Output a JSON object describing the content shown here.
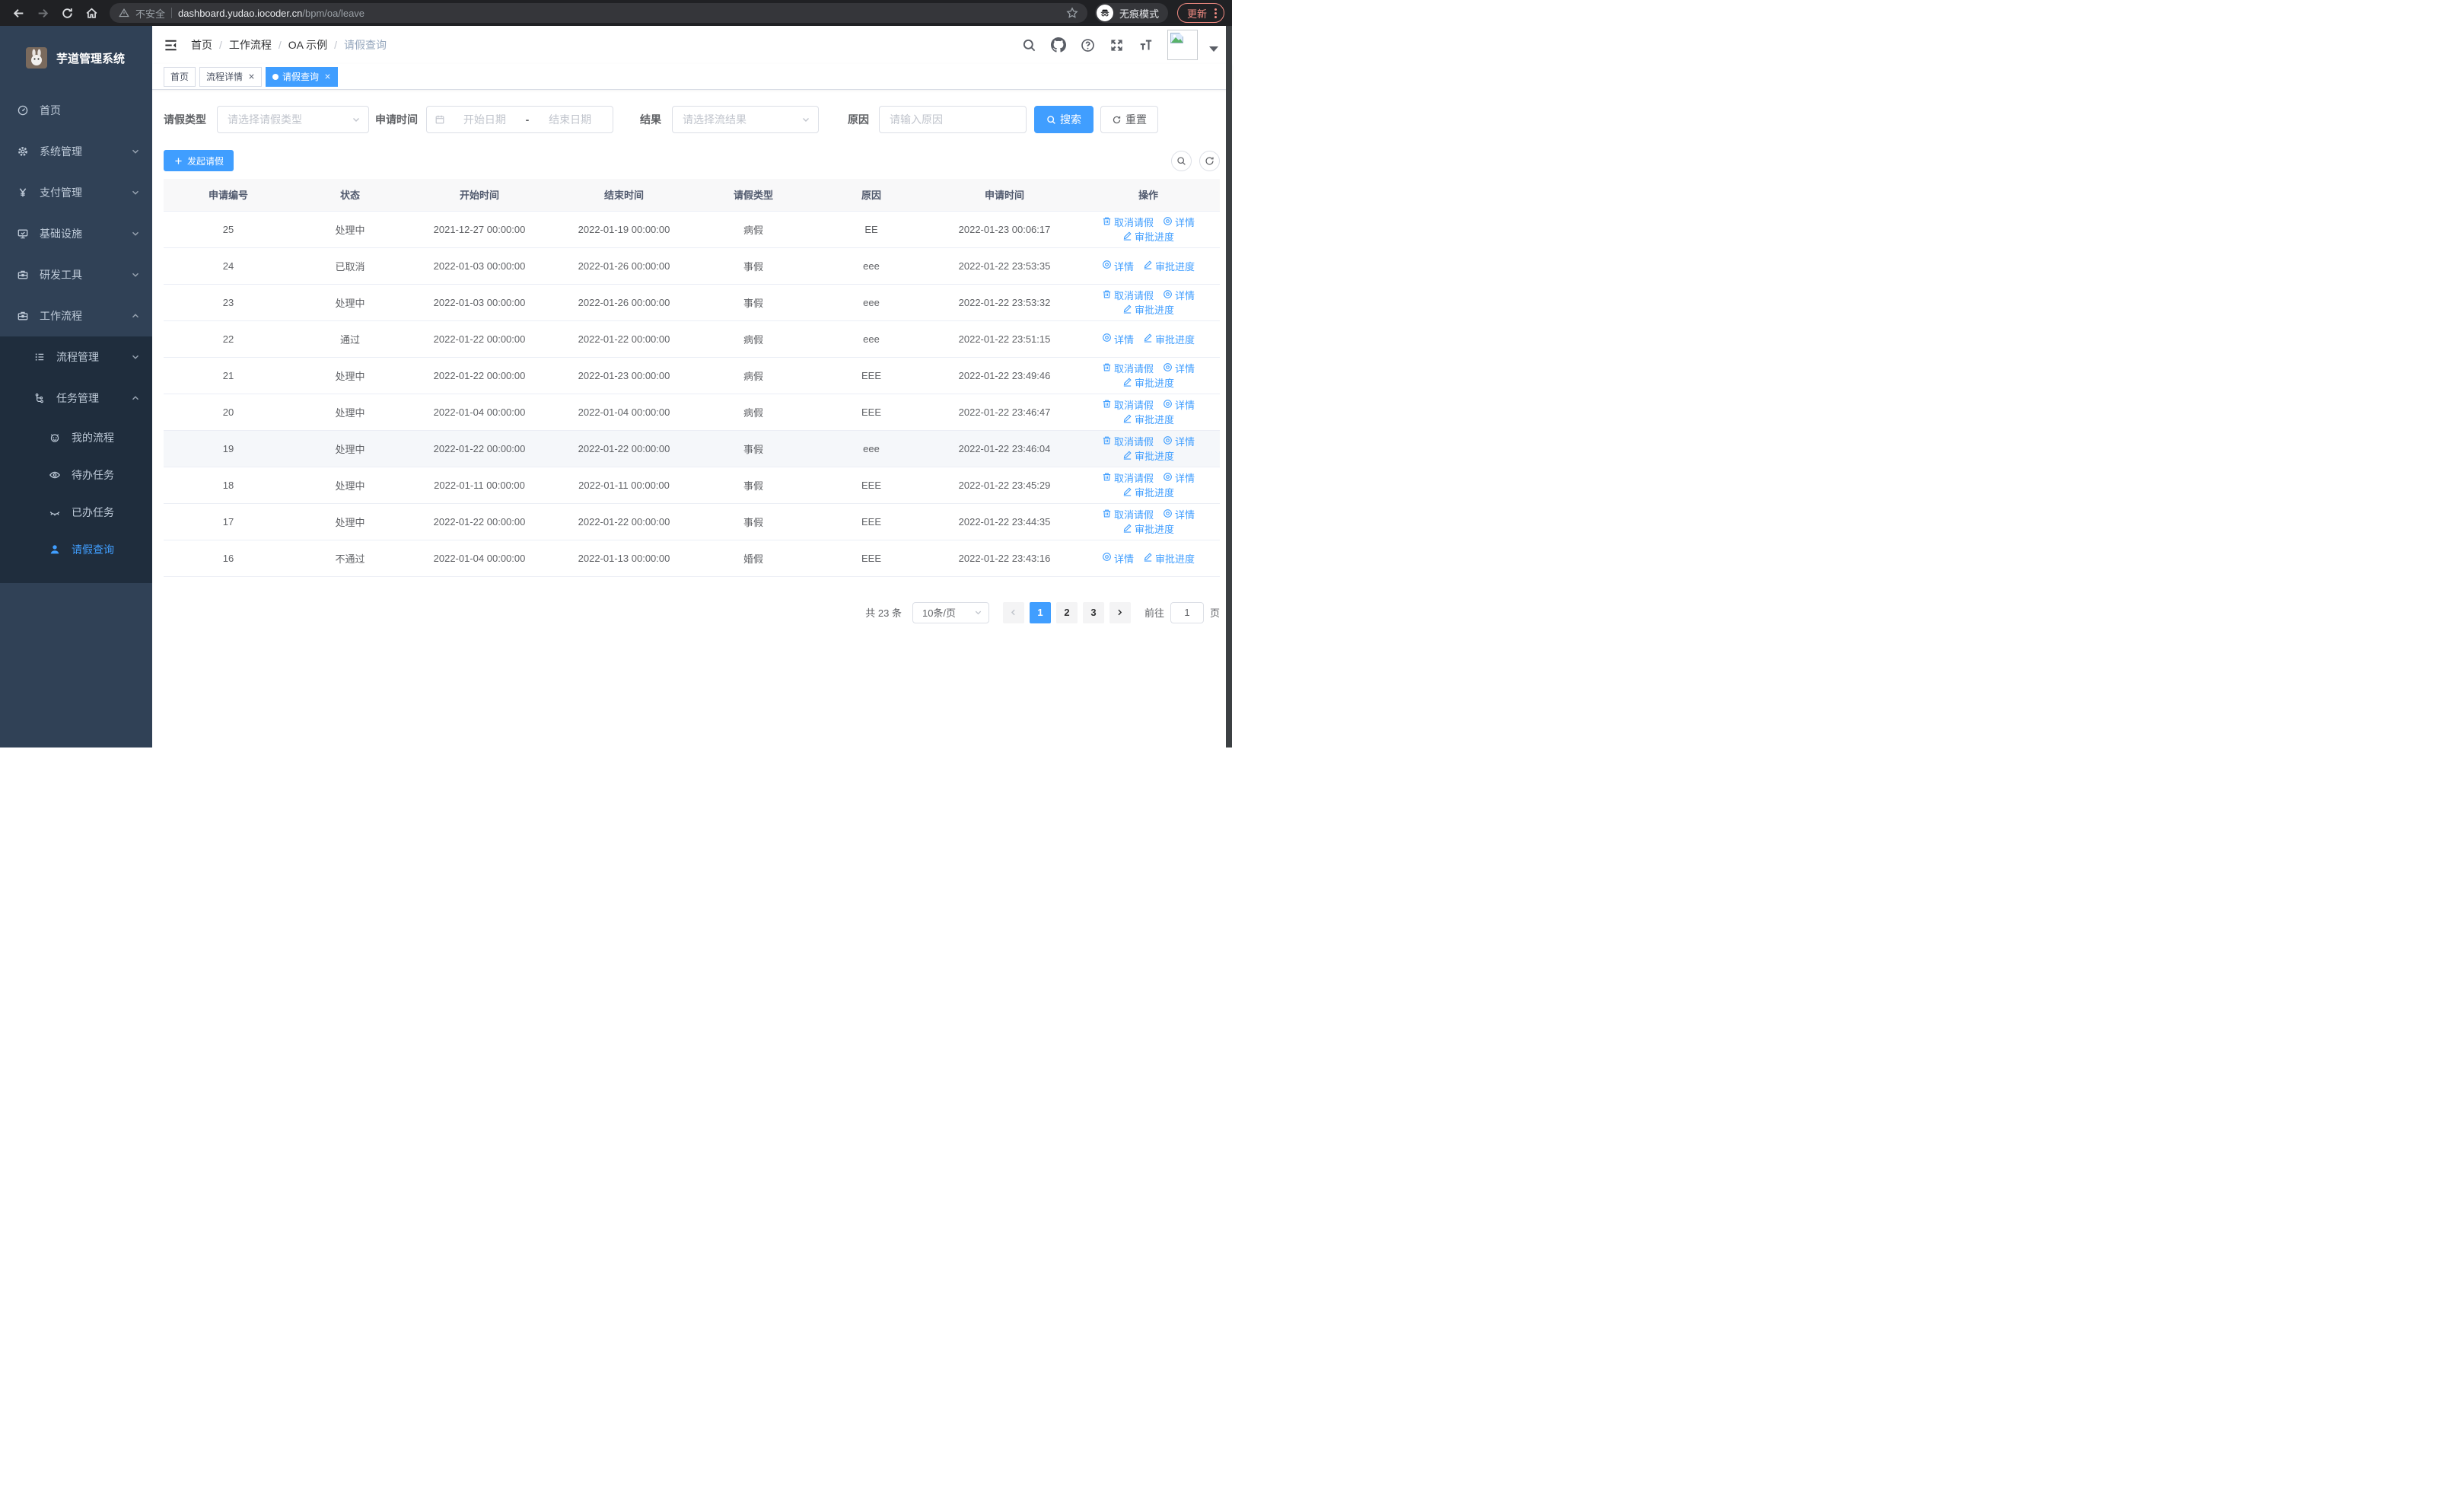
{
  "colors": {
    "primary": "#409eff",
    "sidebar_bg": "#304156",
    "submenu_bg": "#1f2d3d",
    "active_tag": "#409eff",
    "update_accent": "#f28b82"
  },
  "browser": {
    "security_label": "不安全",
    "url_host": "dashboard.yudao.iocoder.cn",
    "url_path": "/bpm/oa/leave",
    "incognito_label": "无痕模式",
    "update_label": "更新"
  },
  "sidebar": {
    "title": "芋道管理系统",
    "items": [
      {
        "label": "首页",
        "icon": "dashboard-icon",
        "level": 1
      },
      {
        "label": "系统管理",
        "icon": "gear-icon",
        "level": 1,
        "chevron": "down"
      },
      {
        "label": "支付管理",
        "icon": "yen-icon",
        "level": 1,
        "chevron": "down"
      },
      {
        "label": "基础设施",
        "icon": "monitor-icon",
        "level": 1,
        "chevron": "down"
      },
      {
        "label": "研发工具",
        "icon": "toolbox-icon",
        "level": 1,
        "chevron": "down"
      },
      {
        "label": "工作流程",
        "icon": "briefcase-icon",
        "level": 1,
        "chevron": "up",
        "open": true
      },
      {
        "label": "流程管理",
        "icon": "list-icon",
        "level": 2,
        "chevron": "down"
      },
      {
        "label": "任务管理",
        "icon": "flow-icon",
        "level": 2,
        "chevron": "up"
      },
      {
        "label": "我的流程",
        "icon": "robot-icon",
        "level": 3
      },
      {
        "label": "待办任务",
        "icon": "eye-open-icon",
        "level": 3
      },
      {
        "label": "已办任务",
        "icon": "eye-closed-icon",
        "level": 3
      },
      {
        "label": "请假查询",
        "icon": "user-icon",
        "level": 3,
        "active": true
      }
    ]
  },
  "navbar": {
    "breadcrumb": [
      {
        "label": "首页"
      },
      {
        "label": "工作流程"
      },
      {
        "label": "OA 示例"
      },
      {
        "label": "请假查询",
        "current": true
      }
    ]
  },
  "tabs": [
    {
      "label": "首页",
      "closable": false,
      "active": false
    },
    {
      "label": "流程详情",
      "closable": true,
      "active": false
    },
    {
      "label": "请假查询",
      "closable": true,
      "active": true
    }
  ],
  "filters": {
    "leave_type": {
      "label": "请假类型",
      "placeholder": "请选择请假类型"
    },
    "apply_time": {
      "label": "申请时间",
      "start_placeholder": "开始日期",
      "separator": "-",
      "end_placeholder": "结束日期"
    },
    "result": {
      "label": "结果",
      "placeholder": "请选择流结果"
    },
    "reason": {
      "label": "原因",
      "placeholder": "请输入原因"
    },
    "search_label": "搜索",
    "reset_label": "重置"
  },
  "toolbar": {
    "create_label": "发起请假"
  },
  "table": {
    "columns": [
      "申请编号",
      "状态",
      "开始时间",
      "结束时间",
      "请假类型",
      "原因",
      "申请时间",
      "操作"
    ],
    "action_labels": {
      "cancel": "取消请假",
      "detail": "详情",
      "progress": "审批进度"
    },
    "rows": [
      {
        "id": "25",
        "status": "处理中",
        "start": "2021-12-27 00:00:00",
        "end": "2022-01-19 00:00:00",
        "type": "病假",
        "reason": "EE",
        "apply": "2022-01-23 00:06:17",
        "actions": [
          "cancel",
          "detail",
          "progress"
        ],
        "highlight": false
      },
      {
        "id": "24",
        "status": "已取消",
        "start": "2022-01-03 00:00:00",
        "end": "2022-01-26 00:00:00",
        "type": "事假",
        "reason": "eee",
        "apply": "2022-01-22 23:53:35",
        "actions": [
          "detail",
          "progress"
        ],
        "highlight": false
      },
      {
        "id": "23",
        "status": "处理中",
        "start": "2022-01-03 00:00:00",
        "end": "2022-01-26 00:00:00",
        "type": "事假",
        "reason": "eee",
        "apply": "2022-01-22 23:53:32",
        "actions": [
          "cancel",
          "detail",
          "progress"
        ],
        "highlight": false
      },
      {
        "id": "22",
        "status": "通过",
        "start": "2022-01-22 00:00:00",
        "end": "2022-01-22 00:00:00",
        "type": "病假",
        "reason": "eee",
        "apply": "2022-01-22 23:51:15",
        "actions": [
          "detail",
          "progress"
        ],
        "highlight": false
      },
      {
        "id": "21",
        "status": "处理中",
        "start": "2022-01-22 00:00:00",
        "end": "2022-01-23 00:00:00",
        "type": "病假",
        "reason": "EEE",
        "apply": "2022-01-22 23:49:46",
        "actions": [
          "cancel",
          "detail",
          "progress"
        ],
        "highlight": false
      },
      {
        "id": "20",
        "status": "处理中",
        "start": "2022-01-04 00:00:00",
        "end": "2022-01-04 00:00:00",
        "type": "病假",
        "reason": "EEE",
        "apply": "2022-01-22 23:46:47",
        "actions": [
          "cancel",
          "detail",
          "progress"
        ],
        "highlight": false
      },
      {
        "id": "19",
        "status": "处理中",
        "start": "2022-01-22 00:00:00",
        "end": "2022-01-22 00:00:00",
        "type": "事假",
        "reason": "eee",
        "apply": "2022-01-22 23:46:04",
        "actions": [
          "cancel",
          "detail",
          "progress"
        ],
        "highlight": true
      },
      {
        "id": "18",
        "status": "处理中",
        "start": "2022-01-11 00:00:00",
        "end": "2022-01-11 00:00:00",
        "type": "事假",
        "reason": "EEE",
        "apply": "2022-01-22 23:45:29",
        "actions": [
          "cancel",
          "detail",
          "progress"
        ],
        "highlight": false
      },
      {
        "id": "17",
        "status": "处理中",
        "start": "2022-01-22 00:00:00",
        "end": "2022-01-22 00:00:00",
        "type": "事假",
        "reason": "EEE",
        "apply": "2022-01-22 23:44:35",
        "actions": [
          "cancel",
          "detail",
          "progress"
        ],
        "highlight": false
      },
      {
        "id": "16",
        "status": "不通过",
        "start": "2022-01-04 00:00:00",
        "end": "2022-01-13 00:00:00",
        "type": "婚假",
        "reason": "EEE",
        "apply": "2022-01-22 23:43:16",
        "actions": [
          "detail",
          "progress"
        ],
        "highlight": false
      }
    ]
  },
  "pagination": {
    "total_label": "共 23 条",
    "page_size_label": "10条/页",
    "pages": [
      "1",
      "2",
      "3"
    ],
    "active_page": "1",
    "goto_label": "前往",
    "goto_value": "1",
    "goto_suffix": "页"
  }
}
